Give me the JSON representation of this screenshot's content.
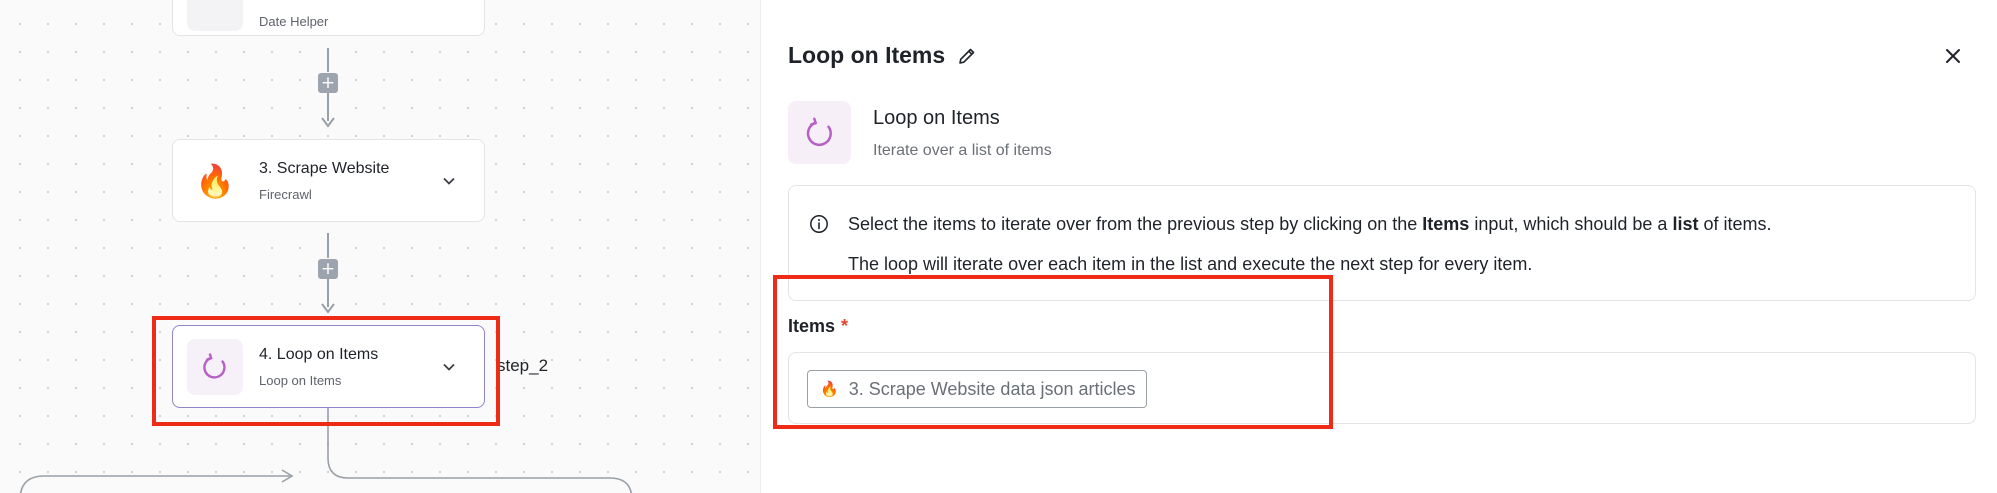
{
  "canvas": {
    "top_node": {
      "subtitle": "Date Helper"
    },
    "scrape_node": {
      "title": "3. Scrape Website",
      "subtitle": "Firecrawl"
    },
    "loop_node": {
      "title": "4. Loop on Items",
      "subtitle": "Loop on Items"
    },
    "branch_label": "step_2"
  },
  "panel": {
    "title": "Loop on Items",
    "step_name": "Loop on Items",
    "step_description": "Iterate over a list of items",
    "info": {
      "line1_before_items": "Select the items to iterate over from the previous step by clicking on the ",
      "line1_items": "Items",
      "line1_between": " input, which should be a ",
      "line1_list": "list",
      "line1_after": " of items.",
      "line2": "The loop will iterate over each item in the list and execute the next step for every item."
    },
    "items_field": {
      "label": "Items",
      "required_mark": "*",
      "chip_text": "3. Scrape Website data json articles"
    }
  },
  "colors": {
    "highlight": "#ee2b17",
    "loop_accent": "#b65fc5",
    "required": "#e5432c"
  }
}
